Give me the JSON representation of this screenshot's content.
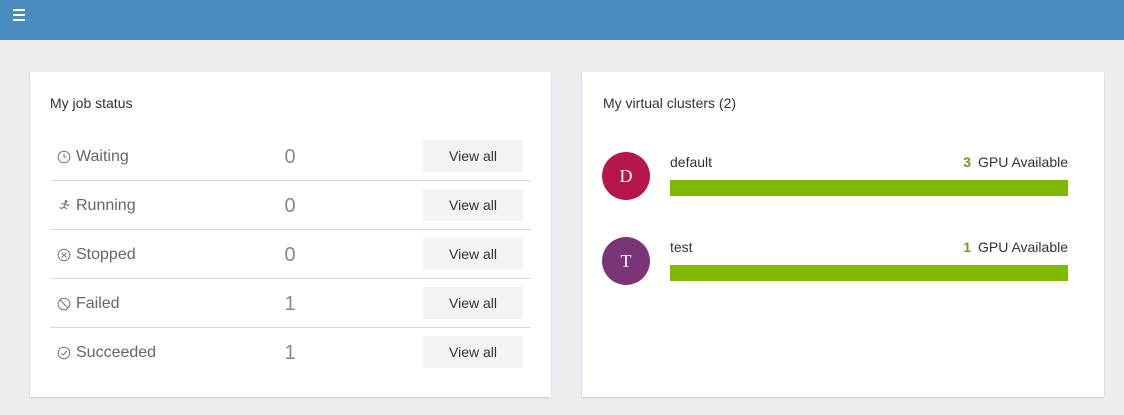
{
  "header": {
    "menu_icon": "hamburger-menu-icon",
    "color": "#4a8cc0"
  },
  "job_status": {
    "title": "My job status",
    "view_label": "View all",
    "rows": [
      {
        "key": "waiting",
        "label": "Waiting",
        "count": "0",
        "icon": "clock-icon"
      },
      {
        "key": "running",
        "label": "Running",
        "count": "0",
        "icon": "running-icon"
      },
      {
        "key": "stopped",
        "label": "Stopped",
        "count": "0",
        "icon": "stopped-circle-x-icon"
      },
      {
        "key": "failed",
        "label": "Failed",
        "count": "1",
        "icon": "failed-prohibited-icon"
      },
      {
        "key": "succeeded",
        "label": "Succeeded",
        "count": "1",
        "icon": "succeeded-check-icon"
      }
    ]
  },
  "virtual_clusters": {
    "title": "My virtual clusters (2)",
    "gpu_suffix": "GPU Available",
    "items": [
      {
        "initial": "D",
        "name": "default",
        "gpu": "3",
        "avatar_color": "#b5174b",
        "available_fraction": 1.0,
        "bar_color": "#7fba00",
        "gpu_color": "#6a9c1f"
      },
      {
        "initial": "T",
        "name": "test",
        "gpu": "1",
        "avatar_color": "#7b3478",
        "available_fraction": 1.0,
        "bar_color": "#7fba00",
        "gpu_color": "#6a9c1f"
      }
    ]
  }
}
